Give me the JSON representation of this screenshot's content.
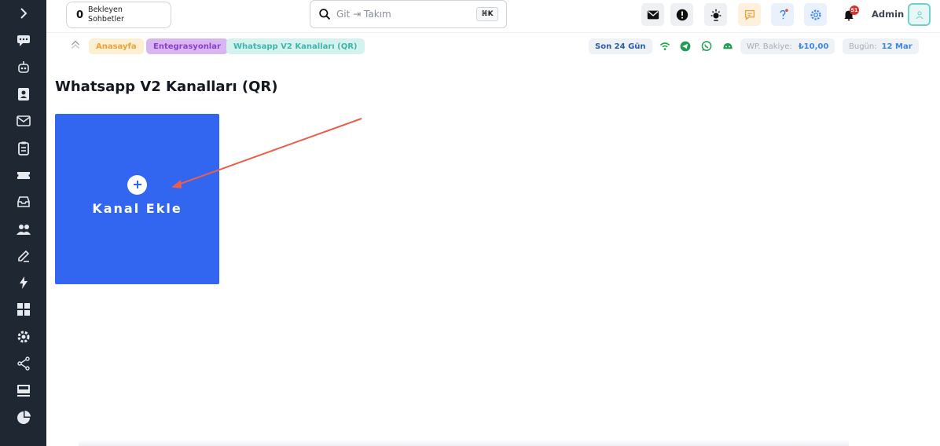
{
  "topbar": {
    "pending_count": "0",
    "pending_label": "Bekleyen Sohbetler",
    "search_placeholder": "Git ⇥ Takım",
    "search_shortcut": "⌘K",
    "notification_count": "51",
    "admin_name": "Admin"
  },
  "breadcrumb": {
    "items": [
      "Anasayfa",
      "Entegrasyonlar",
      "Whatsapp V2 Kanalları (QR)"
    ]
  },
  "status": {
    "period": "Son 24 Gün",
    "balance_label": "WP. Bakiye:",
    "balance_value": "₺10,00",
    "today_label": "Bugün:",
    "today_value": "12 Mar"
  },
  "main": {
    "title": "Whatsapp V2 Kanalları (QR)",
    "add_card_label": "Kanal Ekle"
  },
  "colors": {
    "sidebar_bg": "#1f2733",
    "card_blue": "#3366f0",
    "arrow": "#e8604c"
  }
}
